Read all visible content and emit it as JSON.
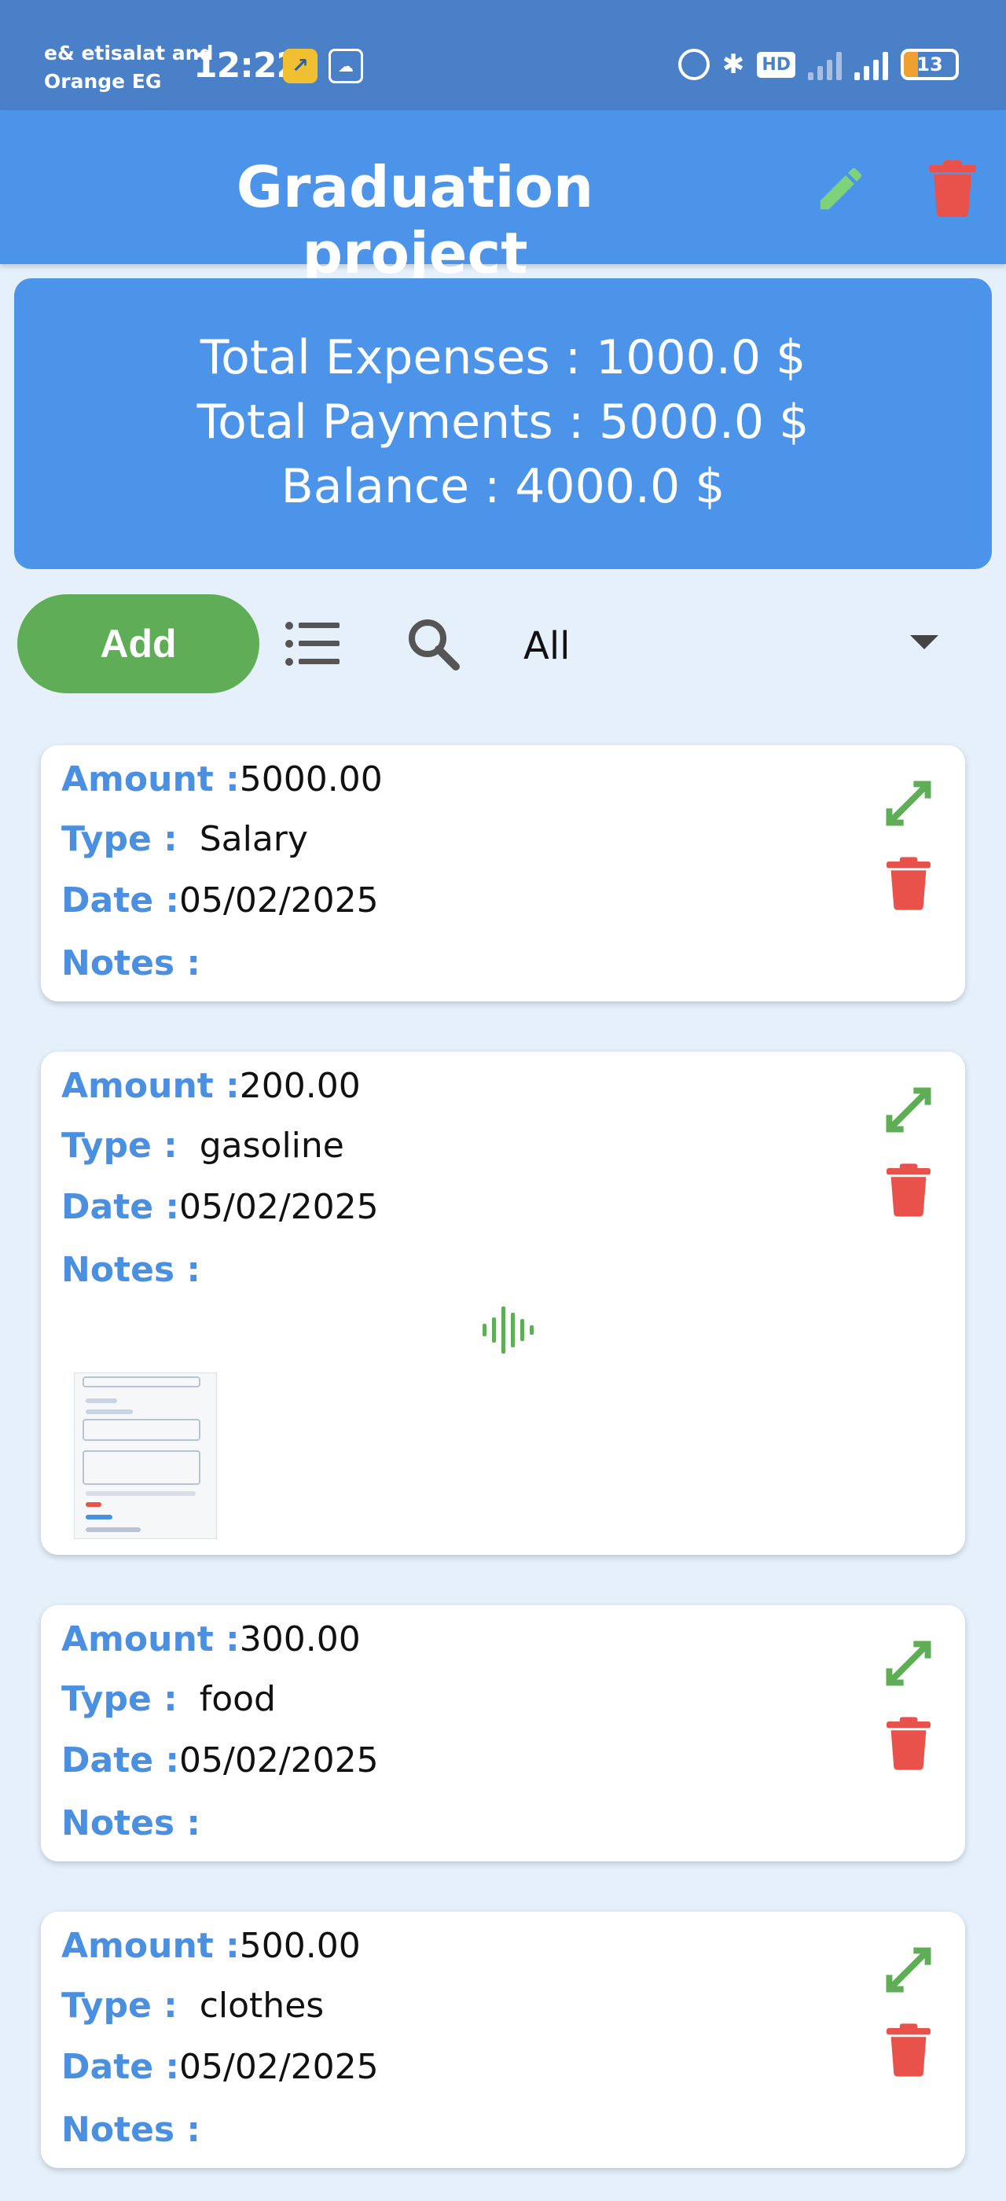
{
  "status_bar": {
    "carrier_line1": "e& etisalat and",
    "carrier_line2": "Orange EG",
    "time": "12:22",
    "hd_label": "HD",
    "battery": "13"
  },
  "header": {
    "title": "Graduation project",
    "colors": {
      "bar": "#4c94ea",
      "edit": "#7ed37a",
      "delete": "#e8524a"
    }
  },
  "summary": {
    "total_expenses": "Total Expenses : 1000.0 $",
    "total_payments": "Total Payments : 5000.0 $",
    "balance": "Balance : 4000.0 $"
  },
  "toolbar": {
    "add_label": "Add",
    "filter_value": "All"
  },
  "labels": {
    "amount": "Amount :",
    "type": "Type :",
    "date": "Date :",
    "notes": "Notes :"
  },
  "transactions": [
    {
      "amount": "5000.00",
      "type": "Salary",
      "date": "05/02/2025",
      "notes": ""
    },
    {
      "amount": "200.00",
      "type": "gasoline",
      "date": "05/02/2025",
      "notes": ""
    },
    {
      "amount": "300.00",
      "type": "food",
      "date": "05/02/2025",
      "notes": ""
    },
    {
      "amount": "500.00",
      "type": "clothes",
      "date": "05/02/2025",
      "notes": ""
    }
  ],
  "icons": {
    "edit": "pencil-icon",
    "delete": "trash-icon",
    "list": "list-icon",
    "search": "search-icon",
    "expand": "expand-icon",
    "audio": "audio-wave-icon"
  }
}
